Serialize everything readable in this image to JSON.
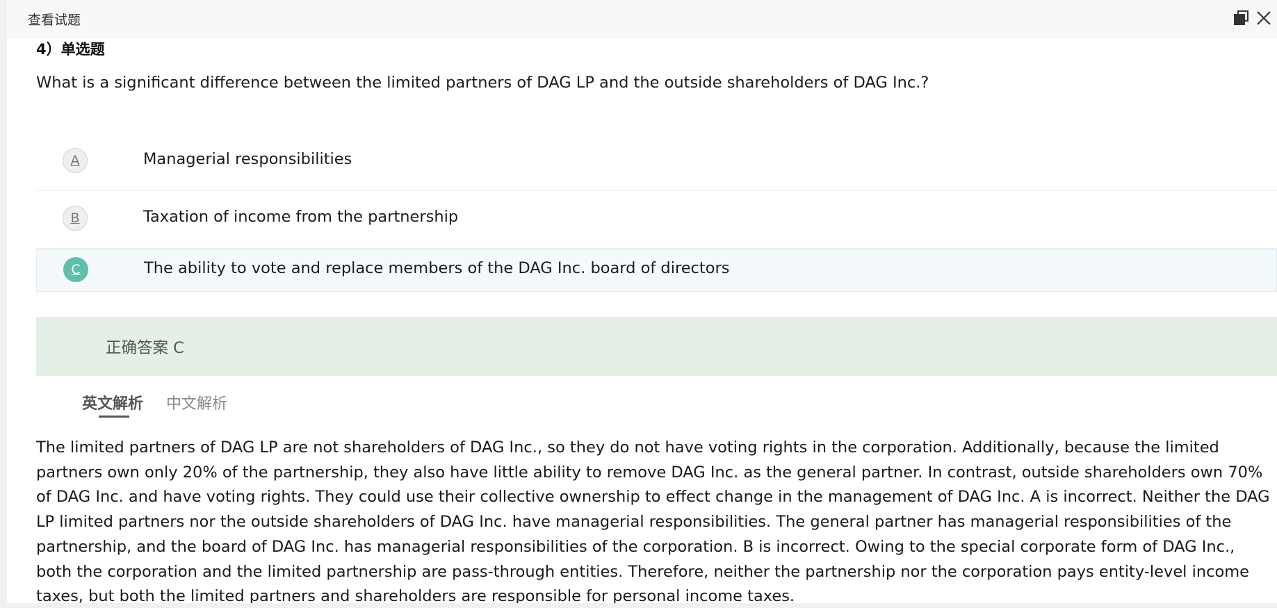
{
  "dialog": {
    "title": "查看试题",
    "icons": {
      "restore": "restore-window-icon",
      "close": "close-icon"
    }
  },
  "question": {
    "type_label": "4）单选题",
    "stem": "What is a significant difference between the limited partners of DAG LP and the outside shareholders of DAG Inc.?",
    "options": [
      {
        "letter": "A",
        "text": "Managerial responsibilities",
        "selected": false
      },
      {
        "letter": "B",
        "text": "Taxation of income from the partnership",
        "selected": false
      },
      {
        "letter": "C",
        "text": "The ability to vote and replace members of the DAG Inc. board of directors",
        "selected": true
      }
    ]
  },
  "answer": {
    "label": "正确答案 C"
  },
  "analysis_tabs": [
    {
      "label": "英文解析",
      "active": true
    },
    {
      "label": "中文解析",
      "active": false
    }
  ],
  "explanation": {
    "text": "The limited partners of DAG LP are not shareholders of DAG Inc., so they do not have voting rights in the corporation. Additionally, because the limited partners own only 20% of the partnership, they also have little ability to remove DAG Inc. as the general partner. In contrast, outside shareholders own 70% of DAG Inc. and have voting rights. They could use their collective ownership to effect change in the management of DAG Inc. A is incorrect. Neither the DAG LP limited partners nor the outside shareholders of DAG Inc. have managerial responsibilities. The general partner has managerial responsibilities of the partnership, and the board of DAG Inc. has managerial responsibilities of the corporation. B is incorrect. Owing to the special corporate form of DAG Inc., both the corporation and the limited partnership are pass-through entities. Therefore, neither the partnership nor the corporation pays entity-level income taxes, but both the limited partners and shareholders are responsible for personal income taxes."
  },
  "colors": {
    "selected_option": "#5cc0aa",
    "answer_bar": "#e4efe5",
    "selected_row": "#f4f9fc"
  }
}
